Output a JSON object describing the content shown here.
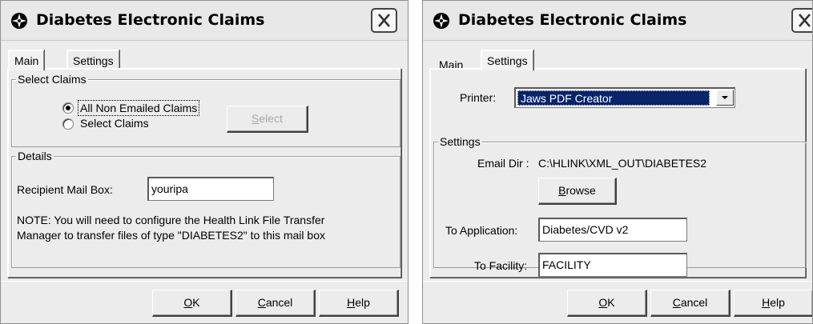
{
  "win1": {
    "title": "Diabetes Electronic Claims",
    "tabs": [
      "Main",
      "Settings"
    ],
    "select_claims_legend": "Select Claims",
    "radio_all": "All Non Emailed Claims",
    "radio_select": "Select Claims",
    "select_button": "Select",
    "select_button_key": "S",
    "select_button_rest": "elect",
    "details_legend": "Details",
    "recipient_label": "Recipient Mail Box:",
    "recipient_value": "youripa",
    "note_line1": "NOTE: You will need to configure the Health Link File Transfer",
    "note_line2": "Manager to transfer files of type \"DIABETES2\" to this mail box",
    "ok_key": "O",
    "ok_rest": "K",
    "cancel_key": "C",
    "cancel_rest": "ancel",
    "help_key": "H",
    "help_rest": "elp"
  },
  "win2": {
    "title": "Diabetes Electronic Claims",
    "tabs": [
      "Main",
      "Settings"
    ],
    "printer_label": "Printer:",
    "printer_value": "Jaws PDF Creator",
    "settings_legend": "Settings",
    "email_dir_label": "Email Dir :",
    "email_dir_value": "C:\\HLINK\\XML_OUT\\DIABETES2",
    "browse_key": "B",
    "browse_rest": "rowse",
    "to_application_label": "To Application:",
    "to_application_value": "Diabetes/CVD v2",
    "to_facility_label": "To Facility:",
    "to_facility_value": "FACILITY",
    "ok_key": "O",
    "ok_rest": "K",
    "cancel_key": "C",
    "cancel_rest": "ancel",
    "help_key": "H",
    "help_rest": "elp"
  },
  "icons": {
    "app_icon": "compass-rose-icon",
    "close_icon": "close-x-icon",
    "dropdown_icon": "chevron-down-icon"
  }
}
